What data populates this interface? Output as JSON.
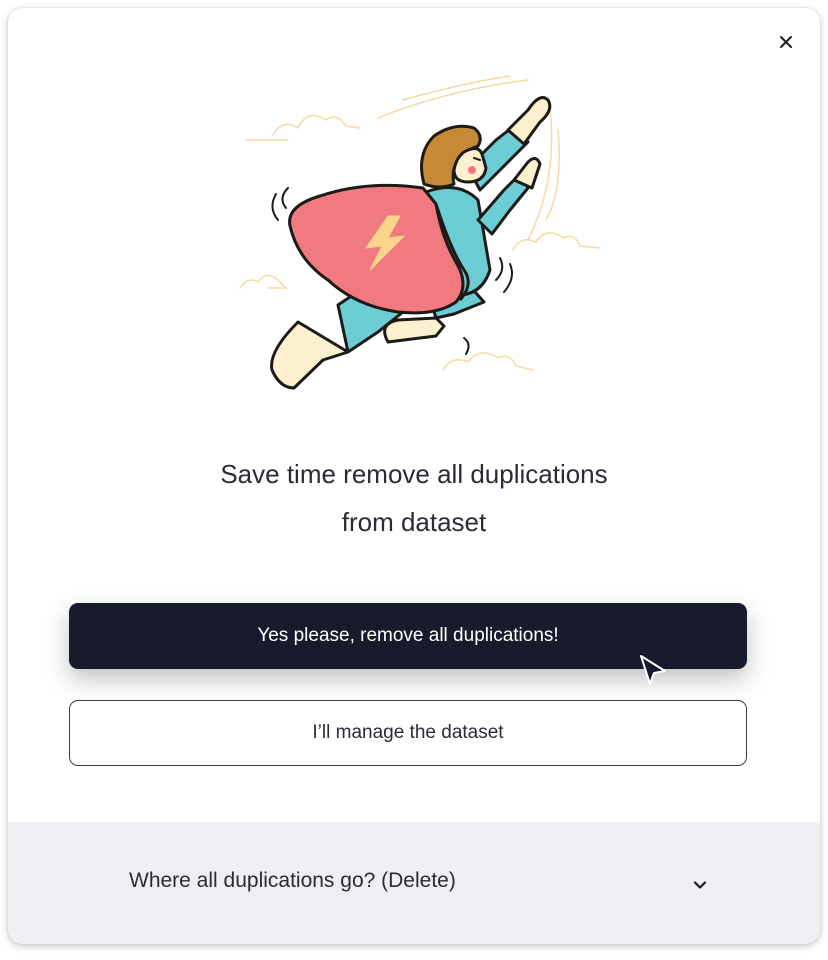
{
  "dialog": {
    "close_label": "×",
    "title_line1": "Save time remove all duplications",
    "title_line2": "from dataset",
    "primary_button": "Yes please, remove all duplications!",
    "secondary_button": "I’ll manage the  dataset",
    "footer_label": "Where all duplications go? (Delete)"
  },
  "icons": {
    "close": "close-icon",
    "chevron": "chevron-down-icon",
    "cursor": "mouse-cursor-icon",
    "illustration": "flying-superhero-illustration"
  },
  "colors": {
    "primary_button": "#181b2b",
    "footer_background": "#eeeff2",
    "cape": "#f07a7f",
    "suit": "#6ccdd5",
    "skin": "#fbf1cf",
    "hair": "#c68a37",
    "clouds": "#f5d9a0"
  }
}
